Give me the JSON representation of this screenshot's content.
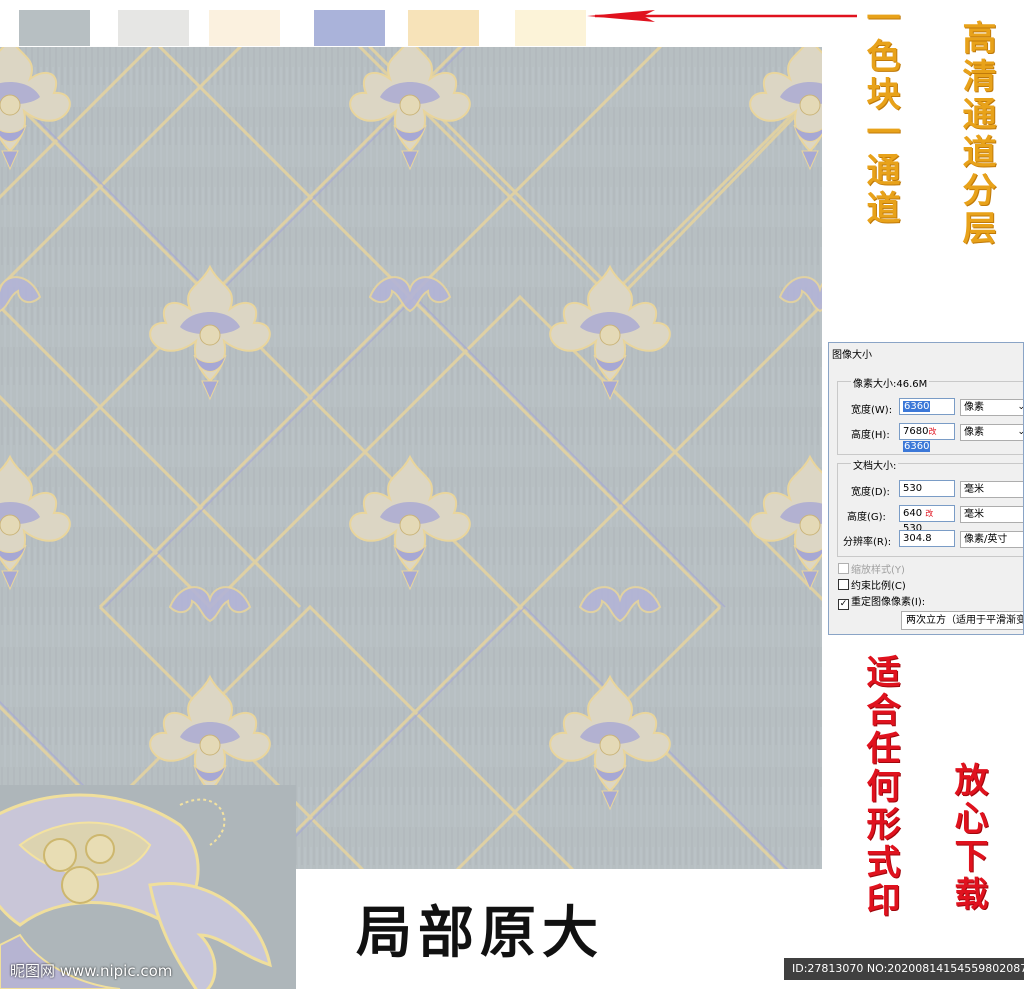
{
  "swatches": [
    {
      "name": "gray",
      "color": "#b7bfc2"
    },
    {
      "name": "light-gray",
      "color": "#e6e6e4"
    },
    {
      "name": "cream",
      "color": "#fbf1df"
    },
    {
      "name": "lavender",
      "color": "#aab3da"
    },
    {
      "name": "wheat",
      "color": "#f7e3b9"
    },
    {
      "name": "pale-yellow",
      "color": "#fcf3d8"
    }
  ],
  "colors": {
    "wallpaper_bg": "#b7bfc2",
    "ornament_gold": "#e7d6a4",
    "ornament_lavender": "#a7a8d4",
    "gold_text": "#e8a21a",
    "red_text": "#e0121e",
    "arrow": "#e0121e"
  },
  "vertical_texts": {
    "one_block_one_channel": "一色块一通道",
    "hd_channel_layer": "高清通道分层",
    "any_form_print": "适合任何形式印",
    "download_safe": "放心下载"
  },
  "caption": "局部原大",
  "watermark": "昵图网 www.nipic.com",
  "id_text": "ID:27813070 NO:20200814154559802087",
  "dialog": {
    "title": "图像大小",
    "pixel_size_label": "像素大小:46.6M",
    "width_label": "宽度(W):",
    "width_value": "6360",
    "width_unit": "像素",
    "height_label": "高度(H):",
    "height_old": "7680",
    "height_mark": "改",
    "height_value": "6360",
    "height_unit": "像素",
    "doc_size_label": "文档大小:",
    "doc_width_label": "宽度(D):",
    "doc_width_value": "530",
    "doc_width_unit": "毫米",
    "doc_height_label": "高度(G):",
    "doc_height_old": "640",
    "doc_height_mark": "改",
    "doc_height_value": "530",
    "doc_height_unit": "毫米",
    "resolution_label": "分辨率(R):",
    "resolution_value": "304.8",
    "resolution_unit": "像素/英寸",
    "scale_styles_label": "缩放样式(Y)",
    "constrain_label": "约束比例(C)",
    "resample_label": "重定图像像素(I):",
    "resample_method": "两次立方（适用于平滑渐变"
  }
}
